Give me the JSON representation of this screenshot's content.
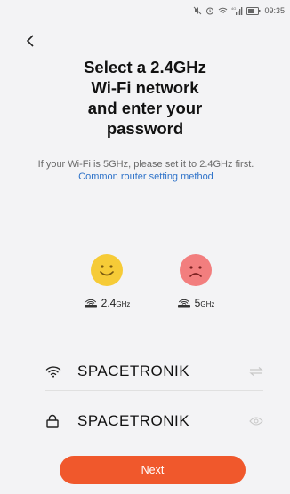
{
  "status_bar": {
    "time": "09:35",
    "signal_text": "4G"
  },
  "header": {
    "back_icon": "chevron-left-icon"
  },
  "title": {
    "line1": "Select a 2.4GHz",
    "line2": "Wi-Fi network",
    "line3": "and enter your",
    "line4": "password"
  },
  "subtitle": {
    "text": "If your Wi-Fi is 5GHz, please set it to 2.4GHz first. ",
    "link": "Common router setting method"
  },
  "bands": [
    {
      "value": "2.4",
      "unit": "GHz",
      "face": "smile-face-icon",
      "color": "#f6cb37"
    },
    {
      "value": "5",
      "unit": "GHz",
      "face": "sad-face-icon",
      "color": "#f27e7e"
    }
  ],
  "form": {
    "ssid": {
      "value": "SPACETRONIK",
      "icon": "wifi-icon",
      "action_icon": "switch-arrows-icon"
    },
    "password": {
      "value": "SPACETRONIK",
      "icon": "lock-icon",
      "action_icon": "eye-icon"
    }
  },
  "next_button": {
    "label": "Next",
    "color": "#f0582c"
  }
}
